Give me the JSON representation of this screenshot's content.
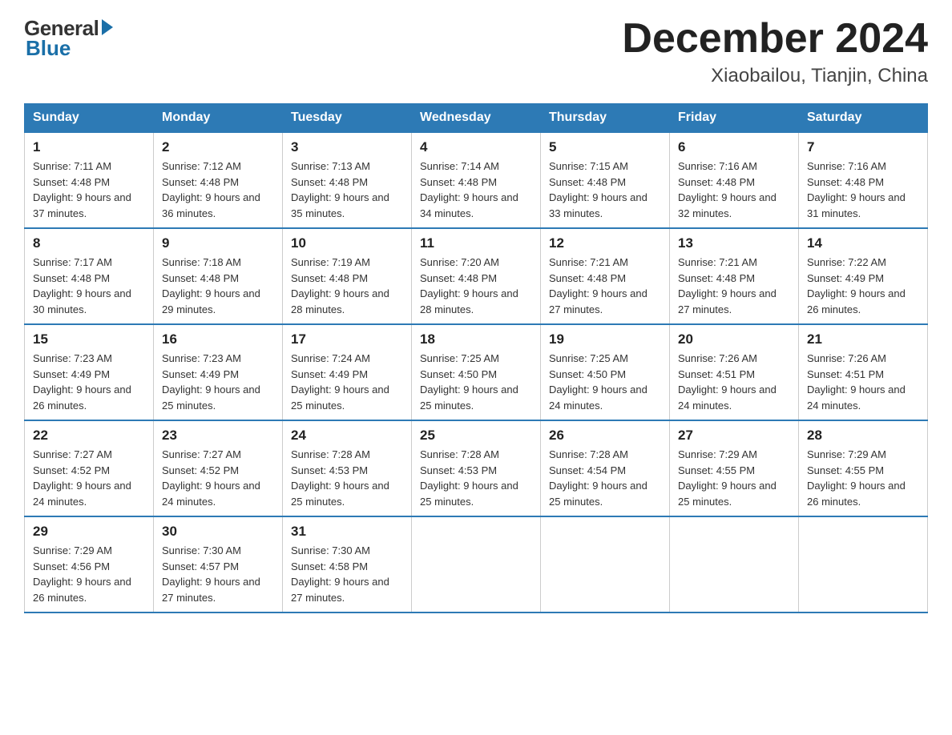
{
  "logo": {
    "general": "General",
    "blue": "Blue"
  },
  "title": "December 2024",
  "subtitle": "Xiaobailou, Tianjin, China",
  "weekdays": [
    "Sunday",
    "Monday",
    "Tuesday",
    "Wednesday",
    "Thursday",
    "Friday",
    "Saturday"
  ],
  "weeks": [
    [
      {
        "day": "1",
        "sunrise": "7:11 AM",
        "sunset": "4:48 PM",
        "daylight": "9 hours and 37 minutes."
      },
      {
        "day": "2",
        "sunrise": "7:12 AM",
        "sunset": "4:48 PM",
        "daylight": "9 hours and 36 minutes."
      },
      {
        "day": "3",
        "sunrise": "7:13 AM",
        "sunset": "4:48 PM",
        "daylight": "9 hours and 35 minutes."
      },
      {
        "day": "4",
        "sunrise": "7:14 AM",
        "sunset": "4:48 PM",
        "daylight": "9 hours and 34 minutes."
      },
      {
        "day": "5",
        "sunrise": "7:15 AM",
        "sunset": "4:48 PM",
        "daylight": "9 hours and 33 minutes."
      },
      {
        "day": "6",
        "sunrise": "7:16 AM",
        "sunset": "4:48 PM",
        "daylight": "9 hours and 32 minutes."
      },
      {
        "day": "7",
        "sunrise": "7:16 AM",
        "sunset": "4:48 PM",
        "daylight": "9 hours and 31 minutes."
      }
    ],
    [
      {
        "day": "8",
        "sunrise": "7:17 AM",
        "sunset": "4:48 PM",
        "daylight": "9 hours and 30 minutes."
      },
      {
        "day": "9",
        "sunrise": "7:18 AM",
        "sunset": "4:48 PM",
        "daylight": "9 hours and 29 minutes."
      },
      {
        "day": "10",
        "sunrise": "7:19 AM",
        "sunset": "4:48 PM",
        "daylight": "9 hours and 28 minutes."
      },
      {
        "day": "11",
        "sunrise": "7:20 AM",
        "sunset": "4:48 PM",
        "daylight": "9 hours and 28 minutes."
      },
      {
        "day": "12",
        "sunrise": "7:21 AM",
        "sunset": "4:48 PM",
        "daylight": "9 hours and 27 minutes."
      },
      {
        "day": "13",
        "sunrise": "7:21 AM",
        "sunset": "4:48 PM",
        "daylight": "9 hours and 27 minutes."
      },
      {
        "day": "14",
        "sunrise": "7:22 AM",
        "sunset": "4:49 PM",
        "daylight": "9 hours and 26 minutes."
      }
    ],
    [
      {
        "day": "15",
        "sunrise": "7:23 AM",
        "sunset": "4:49 PM",
        "daylight": "9 hours and 26 minutes."
      },
      {
        "day": "16",
        "sunrise": "7:23 AM",
        "sunset": "4:49 PM",
        "daylight": "9 hours and 25 minutes."
      },
      {
        "day": "17",
        "sunrise": "7:24 AM",
        "sunset": "4:49 PM",
        "daylight": "9 hours and 25 minutes."
      },
      {
        "day": "18",
        "sunrise": "7:25 AM",
        "sunset": "4:50 PM",
        "daylight": "9 hours and 25 minutes."
      },
      {
        "day": "19",
        "sunrise": "7:25 AM",
        "sunset": "4:50 PM",
        "daylight": "9 hours and 24 minutes."
      },
      {
        "day": "20",
        "sunrise": "7:26 AM",
        "sunset": "4:51 PM",
        "daylight": "9 hours and 24 minutes."
      },
      {
        "day": "21",
        "sunrise": "7:26 AM",
        "sunset": "4:51 PM",
        "daylight": "9 hours and 24 minutes."
      }
    ],
    [
      {
        "day": "22",
        "sunrise": "7:27 AM",
        "sunset": "4:52 PM",
        "daylight": "9 hours and 24 minutes."
      },
      {
        "day": "23",
        "sunrise": "7:27 AM",
        "sunset": "4:52 PM",
        "daylight": "9 hours and 24 minutes."
      },
      {
        "day": "24",
        "sunrise": "7:28 AM",
        "sunset": "4:53 PM",
        "daylight": "9 hours and 25 minutes."
      },
      {
        "day": "25",
        "sunrise": "7:28 AM",
        "sunset": "4:53 PM",
        "daylight": "9 hours and 25 minutes."
      },
      {
        "day": "26",
        "sunrise": "7:28 AM",
        "sunset": "4:54 PM",
        "daylight": "9 hours and 25 minutes."
      },
      {
        "day": "27",
        "sunrise": "7:29 AM",
        "sunset": "4:55 PM",
        "daylight": "9 hours and 25 minutes."
      },
      {
        "day": "28",
        "sunrise": "7:29 AM",
        "sunset": "4:55 PM",
        "daylight": "9 hours and 26 minutes."
      }
    ],
    [
      {
        "day": "29",
        "sunrise": "7:29 AM",
        "sunset": "4:56 PM",
        "daylight": "9 hours and 26 minutes."
      },
      {
        "day": "30",
        "sunrise": "7:30 AM",
        "sunset": "4:57 PM",
        "daylight": "9 hours and 27 minutes."
      },
      {
        "day": "31",
        "sunrise": "7:30 AM",
        "sunset": "4:58 PM",
        "daylight": "9 hours and 27 minutes."
      },
      null,
      null,
      null,
      null
    ]
  ]
}
